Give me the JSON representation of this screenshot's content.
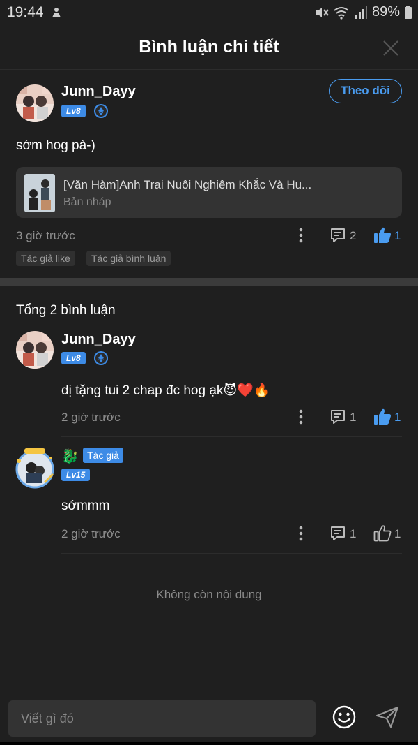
{
  "status_bar": {
    "time": "19:44",
    "battery": "89%"
  },
  "header": {
    "title": "Bình luận chi tiết"
  },
  "post": {
    "username": "Junn_Dayy",
    "level": "Lv8",
    "follow_label": "Theo dõi",
    "text": "sớm hog pà-)",
    "story": {
      "title": "[Văn Hàm]Anh Trai Nuôi Nghiêm Khắc Và Hu...",
      "subtitle": "Bản nháp"
    },
    "time": "3 giờ trước",
    "comment_count": "2",
    "like_count": "1",
    "tags": [
      "Tác giả like",
      "Tác giả bình luận"
    ]
  },
  "comments_section": {
    "title": "Tổng 2 bình luận",
    "comments": [
      {
        "username": "Junn_Dayy",
        "level": "Lv8",
        "text": "dị tặng tui 2 chap đc hog ạk😈❤️🔥",
        "time": "2 giờ trước",
        "comment_count": "1",
        "like_count": "1",
        "liked": true
      },
      {
        "name_emoji": "🐉",
        "author_tag": "Tác giả",
        "level": "Lv15",
        "text": "sớmmm",
        "time": "2 giờ trước",
        "comment_count": "1",
        "like_count": "1",
        "liked": false
      }
    ]
  },
  "end_text": "Không còn nội dung",
  "input": {
    "placeholder": "Viết gì đó"
  },
  "colors": {
    "accent": "#3d8be6",
    "background": "#1f1f1f"
  }
}
